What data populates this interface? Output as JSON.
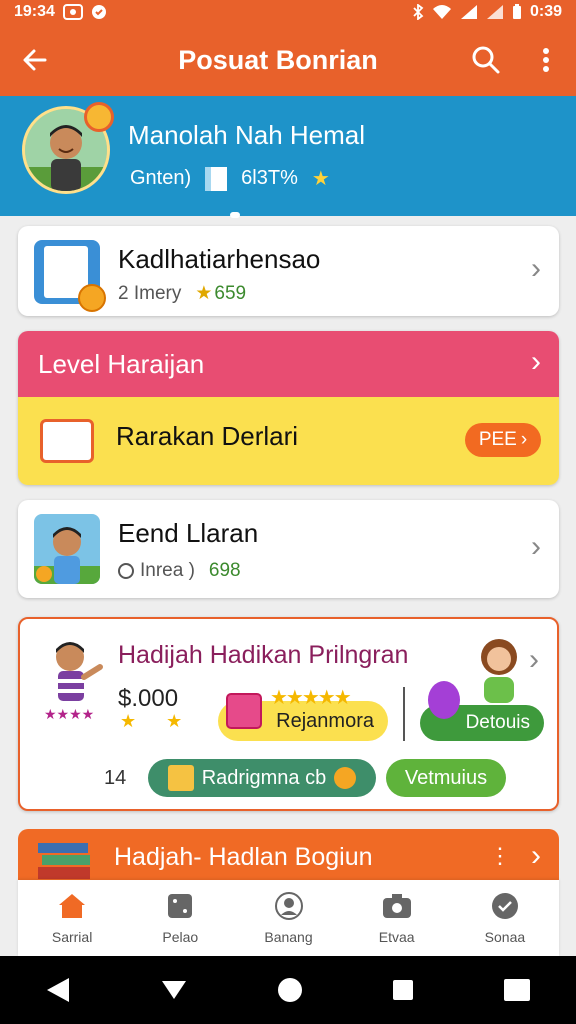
{
  "status_bar": {
    "time": "19:34",
    "right_time": "0:39"
  },
  "app_bar": {
    "title": "Posuat Bonrian"
  },
  "profile": {
    "name": "Manolah Nah Hemal",
    "meta_left": "Gnten)",
    "meta_right": "6l3T%",
    "star": "★"
  },
  "rows": [
    {
      "title": "Kadlhatiarhensao",
      "sub_left": "2 Imery",
      "sub_right": "659"
    },
    {
      "title": "Eend Llaran",
      "sub_left": "Inrea )",
      "sub_right": "698"
    }
  ],
  "level": {
    "header": "Level Haraijan",
    "body_title": "Rarakan Derlari",
    "pill": "PEE"
  },
  "promo": {
    "title": "Hadijah Hadikan Prilngran",
    "amount": "$.000",
    "yellow_button": "Rejanmora",
    "green_button_1": "Detouis",
    "count": "14",
    "green_button_2": "Radrigmna cb",
    "green_button_3": "Vetmuius"
  },
  "section5": {
    "title": "Hadjah- Hadlan Bogiun"
  },
  "bottom_nav": [
    {
      "label": "Sarrial",
      "icon": "home-icon"
    },
    {
      "label": "Pelao",
      "icon": "dice-icon"
    },
    {
      "label": "Banang",
      "icon": "profile-icon"
    },
    {
      "label": "Etvaa",
      "icon": "camera-icon"
    },
    {
      "label": "Sonaa",
      "icon": "badge-icon"
    }
  ],
  "colors": {
    "primary": "#e8612b",
    "profile_bg": "#1e93c9",
    "level_header": "#e84d72",
    "level_body": "#fbe04f",
    "green": "#3e9a3c"
  }
}
